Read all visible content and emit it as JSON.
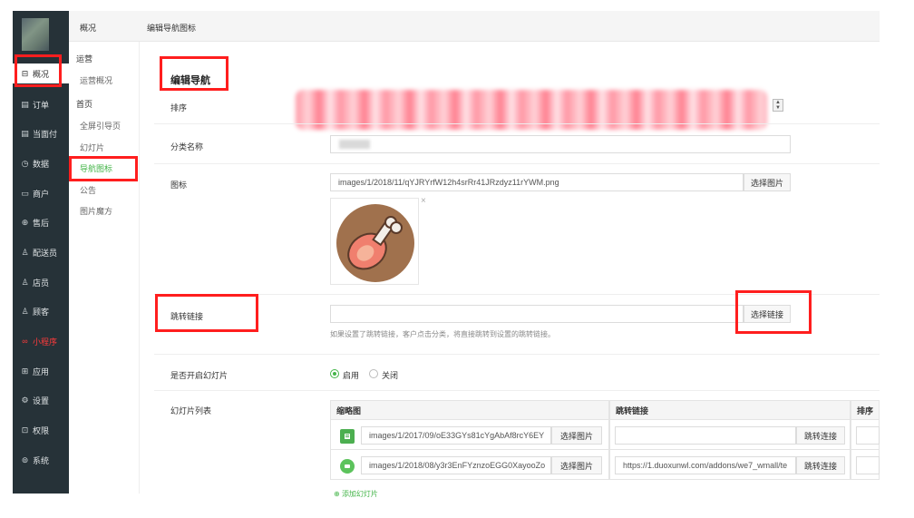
{
  "sidebar": {
    "items": [
      {
        "label": "概况",
        "icon": "overview-icon",
        "glyph": "⊟"
      },
      {
        "label": "订单",
        "icon": "order-icon",
        "glyph": "▤"
      },
      {
        "label": "当面付",
        "icon": "face-pay-icon",
        "glyph": "▤"
      },
      {
        "label": "数据",
        "icon": "data-icon",
        "glyph": "◷"
      },
      {
        "label": "商户",
        "icon": "merchant-icon",
        "glyph": "▭"
      },
      {
        "label": "售后",
        "icon": "after-sale-icon",
        "glyph": "⊕"
      },
      {
        "label": "配送员",
        "icon": "courier-icon",
        "glyph": "♙"
      },
      {
        "label": "店员",
        "icon": "clerk-icon",
        "glyph": "♙"
      },
      {
        "label": "顾客",
        "icon": "customer-icon",
        "glyph": "♙"
      },
      {
        "label": "小程序",
        "icon": "mini-program-icon",
        "glyph": "∞"
      },
      {
        "label": "应用",
        "icon": "apps-icon",
        "glyph": "⊞"
      },
      {
        "label": "设置",
        "icon": "settings-icon",
        "glyph": "⚙"
      },
      {
        "label": "权限",
        "icon": "lock-icon",
        "glyph": "⊡"
      },
      {
        "label": "系统",
        "icon": "system-icon",
        "glyph": "⊚"
      }
    ]
  },
  "subnav": {
    "title": "概况",
    "groups": [
      {
        "label": "运营",
        "links": [
          "运营概况"
        ]
      },
      {
        "label": "首页",
        "links": [
          "全屏引导页",
          "幻灯片",
          "导航图标",
          "公告",
          "图片魔方"
        ]
      }
    ]
  },
  "breadcrumb": "编辑导航图标",
  "form": {
    "section_title": "编辑导航",
    "sort_label": "排序",
    "category_label": "分类名称",
    "icon_label": "图标",
    "icon_path": "images/1/2018/11/qYJRYrfW12h4srRr41JRzdyz11rYWM.png",
    "choose_image": "选择图片",
    "remove_mark": "×",
    "link_label": "跳转链接",
    "choose_link": "选择链接",
    "link_hint": "如果设置了跳转链接，客户点击分类，将直接跳转到设置的跳转链接。",
    "slide_enable_label": "是否开启幻灯片",
    "enable": "启用",
    "disable": "关闭",
    "slide_list_label": "幻灯片列表"
  },
  "table": {
    "headers": [
      "缩略图",
      "跳转链接",
      "排序"
    ],
    "rows": [
      {
        "img": "images/1/2017/09/oE33GYs81cYgAbAf8rcY6EY",
        "btn": "选择图片",
        "link": "",
        "link_btn": "跳转连接"
      },
      {
        "img": "images/1/2018/08/y3r3EnFYznzoEGG0XayooZo",
        "btn": "选择图片",
        "link": "https://1.duoxunwl.com/addons/we7_wmall/te",
        "link_btn": "跳转连接"
      }
    ],
    "add_label": "添加幻灯片"
  },
  "colors": {
    "accent": "#44b549",
    "sidebar_bg": "#263238",
    "highlight": "#ff1e1e"
  }
}
